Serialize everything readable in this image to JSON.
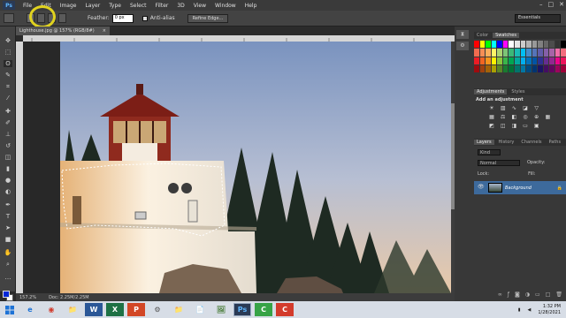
{
  "menubar": {
    "logo": "Ps",
    "items": [
      "File",
      "Edit",
      "Image",
      "Layer",
      "Type",
      "Select",
      "Filter",
      "3D",
      "View",
      "Window",
      "Help"
    ],
    "window_controls": [
      "–",
      "□",
      "✕"
    ]
  },
  "options": {
    "feather_label": "Feather:",
    "feather_value": "0 px",
    "antialias_label": "Anti-alias",
    "refine_edge_label": "Refine Edge...",
    "workspace": "Essentials"
  },
  "document": {
    "tab_title": "Lighthouse.jpg @ 157% (RGB/8#)",
    "tab_close": "×",
    "zoom": "157.2%",
    "doc_size": "Doc: 2.25M/2.25M"
  },
  "panels": {
    "color_tabs": [
      "Color",
      "Swatches"
    ],
    "adjust_tabs": [
      "Adjustments",
      "Styles"
    ],
    "add_adjustment": "Add an adjustment",
    "layers_tabs": [
      "Layers",
      "History",
      "Channels",
      "Paths"
    ],
    "kind_label": "Kind",
    "blend_mode": "Normal",
    "opacity_label": "Opacity:",
    "lock_label": "Lock:",
    "fill_label": "Fill:",
    "layer_name": "Background",
    "swatch_colors": [
      "#ff0000",
      "#ffff00",
      "#00ff00",
      "#00ffff",
      "#0000ff",
      "#ff00ff",
      "#ffffff",
      "#e6e6e6",
      "#cccccc",
      "#b3b3b3",
      "#999999",
      "#808080",
      "#666666",
      "#4d4d4d",
      "#333333",
      "#000000",
      "#f26c4f",
      "#f68e55",
      "#fbaf5c",
      "#fff467",
      "#acd372",
      "#7cc576",
      "#3bb878",
      "#1abbb4",
      "#00bff3",
      "#438ccb",
      "#5574b9",
      "#605ca8",
      "#855fa8",
      "#a763a8",
      "#f06ea9",
      "#f26d7d",
      "#ed1c24",
      "#f26522",
      "#f7941d",
      "#fff200",
      "#8dc63f",
      "#39b54a",
      "#00a651",
      "#00a99d",
      "#00aeef",
      "#0072bc",
      "#0054a6",
      "#2e3192",
      "#662d91",
      "#92278f",
      "#ec008c",
      "#ed145b",
      "#9e0b0f",
      "#a0410d",
      "#a36209",
      "#aba000",
      "#598527",
      "#197b30",
      "#007236",
      "#00746b",
      "#0076a3",
      "#004a80",
      "#003471",
      "#1b1464",
      "#440e62",
      "#630460",
      "#9e005d",
      "#9e0039"
    ]
  },
  "taskbar": {
    "apps": [
      "⊞",
      "e",
      "◉",
      "📁",
      "W",
      "X",
      "P",
      "⚙",
      "📁",
      "📄",
      "🖼",
      "Ps",
      "C",
      "C"
    ],
    "time": "1:32 PM",
    "date": "1/28/2021"
  }
}
